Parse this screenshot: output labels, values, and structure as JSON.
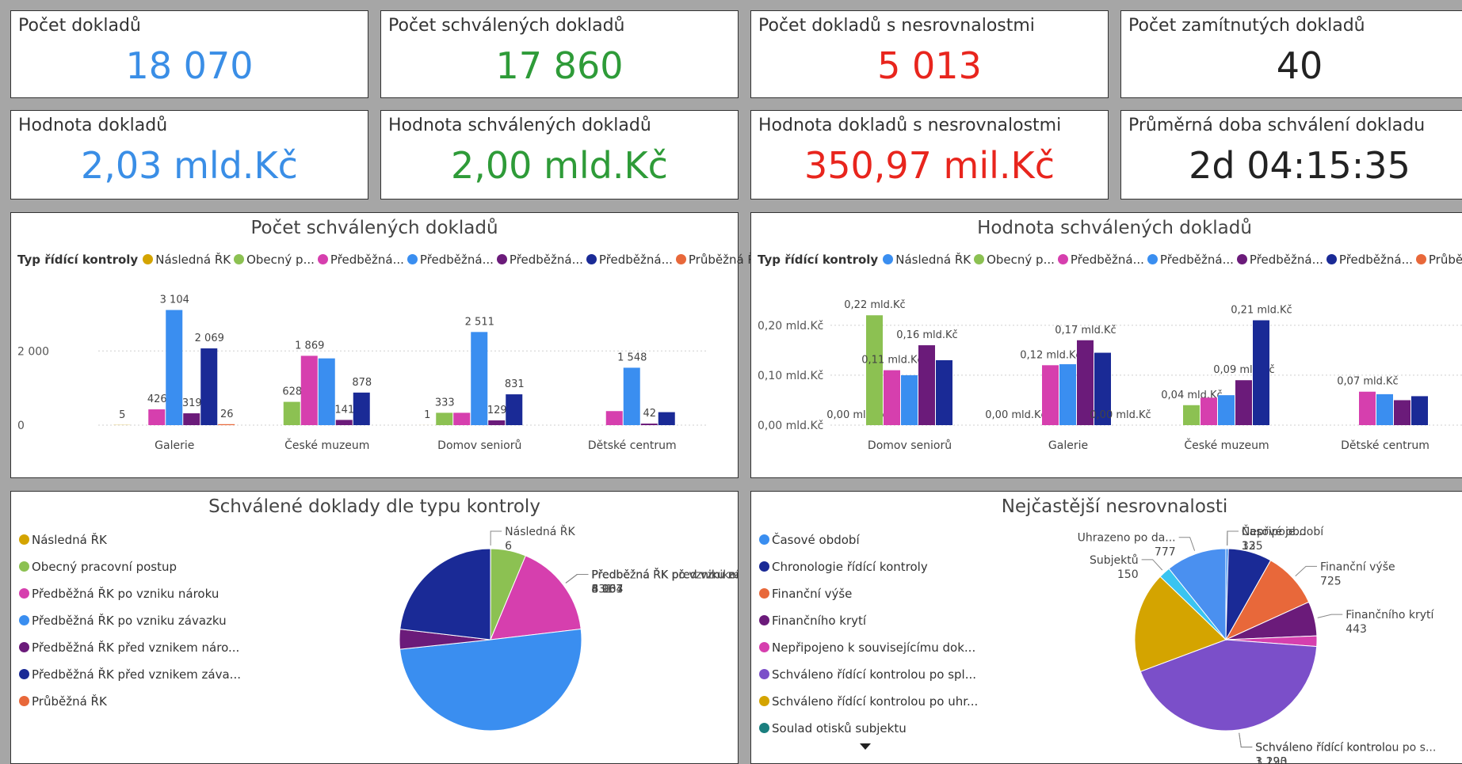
{
  "kpis": [
    {
      "label": "Počet dokladů",
      "value": "18 070",
      "color": "#3a8ee6"
    },
    {
      "label": "Počet schválených dokladů",
      "value": "17 860",
      "color": "#2e9b38"
    },
    {
      "label": "Počet dokladů s nesrovnalostmi",
      "value": "5 013",
      "color": "#e8251d"
    },
    {
      "label": "Počet zamítnutých dokladů",
      "value": "40",
      "color": "#222222"
    },
    {
      "label": "Hodnota dokladů",
      "value": "2,03 mld.Kč",
      "color": "#3a8ee6"
    },
    {
      "label": "Hodnota schválených dokladů",
      "value": "2,00 mld.Kč",
      "color": "#2e9b38"
    },
    {
      "label": "Hodnota dokladů s nesrovnalostmi",
      "value": "350,97 mil.Kč",
      "color": "#e8251d"
    },
    {
      "label": "Průměrná doba schválení dokladu",
      "value": "2d 04:15:35",
      "color": "#222222"
    }
  ],
  "legend_types": {
    "title": "Typ řídící kontroly",
    "items": [
      {
        "label": "Následná ŘK",
        "color": "#d4a400"
      },
      {
        "label": "Obecný p...",
        "color": "#8cc152"
      },
      {
        "label": "Předběžná...",
        "color": "#d63fae"
      },
      {
        "label": "Předběžná...",
        "color": "#3a8ef0"
      },
      {
        "label": "Předběžná...",
        "color": "#6b1b7a"
      },
      {
        "label": "Předběžná...",
        "color": "#1a2a96"
      },
      {
        "label": "Průběžná ŘK",
        "color": "#e8683a"
      }
    ]
  },
  "legend_types_right": {
    "title": "Typ řídící kontroly",
    "items": [
      {
        "label": "Následná ŘK",
        "color": "#3a8ef0"
      },
      {
        "label": "Obecný p...",
        "color": "#8cc152"
      },
      {
        "label": "Předběžná...",
        "color": "#d63fae"
      },
      {
        "label": "Předběžná...",
        "color": "#3a8ef0"
      },
      {
        "label": "Předběžná...",
        "color": "#6b1b7a"
      },
      {
        "label": "Předběžná...",
        "color": "#1a2a96"
      },
      {
        "label": "Průběžná Ř",
        "color": "#e8683a"
      }
    ]
  },
  "chart_data": [
    {
      "type": "bar",
      "title": "Počet schválených dokladů",
      "categories": [
        "Galerie",
        "České muzeum",
        "Domov seniorů",
        "Dětské centrum"
      ],
      "yticks": [
        {
          "v": 0,
          "label": "0"
        },
        {
          "v": 2000,
          "label": "2 000"
        }
      ],
      "ylim": [
        0,
        3500
      ],
      "series": [
        {
          "name": "Následná ŘK",
          "color": "#d4a400",
          "values": [
            5,
            0,
            1,
            0
          ],
          "labels": [
            "5",
            "",
            "1",
            ""
          ]
        },
        {
          "name": "Obecný p...",
          "color": "#8cc152",
          "values": [
            0,
            628,
            333,
            0
          ],
          "labels": [
            "",
            "628",
            "333",
            ""
          ]
        },
        {
          "name": "Předběžná...",
          "color": "#d63fae",
          "values": [
            426,
            1869,
            333,
            379
          ],
          "labels": [
            "426",
            "1 869",
            "",
            ""
          ]
        },
        {
          "name": "Předběžná...",
          "color": "#3a8ef0",
          "values": [
            3104,
            1800,
            2511,
            1548
          ],
          "labels": [
            "3 104",
            "",
            "2 511",
            "1 548"
          ]
        },
        {
          "name": "Předběžná...",
          "color": "#6b1b7a",
          "values": [
            319,
            141,
            129,
            42
          ],
          "labels": [
            "319",
            "141",
            "129",
            "42"
          ]
        },
        {
          "name": "Předběžná...",
          "color": "#1a2a96",
          "values": [
            2069,
            878,
            831,
            350
          ],
          "labels": [
            "2 069",
            "878",
            "831",
            ""
          ]
        },
        {
          "name": "Průběžná ŘK",
          "color": "#e8683a",
          "values": [
            26,
            0,
            0,
            0
          ],
          "labels": [
            "26",
            "",
            "",
            ""
          ]
        }
      ]
    },
    {
      "type": "bar",
      "title": "Hodnota schválených dokladů",
      "categories": [
        "Domov seniorů",
        "Galerie",
        "České muzeum",
        "Dětské centrum"
      ],
      "yticks": [
        {
          "v": 0,
          "label": "0,00 mld.Kč"
        },
        {
          "v": 0.1,
          "label": "0,10 mld.Kč"
        },
        {
          "v": 0.2,
          "label": "0,20 mld.Kč"
        }
      ],
      "ylim": [
        0,
        0.26
      ],
      "series": [
        {
          "name": "Následná ŘK",
          "color": "#3a8ef0",
          "values": [
            0,
            0,
            0,
            0
          ],
          "labels": [
            "0,00 mld.Kč",
            "0,00 mld.Kč",
            "",
            ""
          ]
        },
        {
          "name": "Obecný p...",
          "color": "#8cc152",
          "values": [
            0.22,
            0,
            0.04,
            0
          ],
          "labels": [
            "0,22 mld.Kč",
            "",
            "0,04 mld.Kč",
            ""
          ]
        },
        {
          "name": "Předběžná...",
          "color": "#d63fae",
          "values": [
            0.11,
            0.12,
            0.055,
            0.067
          ],
          "labels": [
            "0,11 mld.Kč",
            "0,12 mld.Kč",
            "",
            "0,07 mld.Kč"
          ]
        },
        {
          "name": "Předběžná...",
          "color": "#3a8ef0",
          "values": [
            0.1,
            0.122,
            0.06,
            0.062
          ],
          "labels": [
            "",
            "",
            "",
            ""
          ]
        },
        {
          "name": "Předběžná...",
          "color": "#6b1b7a",
          "values": [
            0.16,
            0.17,
            0.09,
            0.05
          ],
          "labels": [
            "0,16 mld.Kč",
            "0,17 mld.Kč",
            "0,09 mld.Kč",
            ""
          ]
        },
        {
          "name": "Předběžná...",
          "color": "#1a2a96",
          "values": [
            0.13,
            0.145,
            0.21,
            0.058
          ],
          "labels": [
            "",
            "",
            "0,21 mld.Kč",
            ""
          ]
        },
        {
          "name": "Průběžná Ř",
          "color": "#e8683a",
          "values": [
            0,
            0,
            0,
            0
          ],
          "labels": [
            "",
            "0,00 mld.Kč",
            "",
            ""
          ]
        }
      ]
    },
    {
      "type": "pie",
      "title": "Schválené doklady dle typu kontroly",
      "legend": [
        {
          "label": "Následná ŘK",
          "color": "#d4a400"
        },
        {
          "label": "Obecný pracovní postup",
          "color": "#8cc152"
        },
        {
          "label": "Předběžná ŘK po vzniku nároku",
          "color": "#d63fae"
        },
        {
          "label": "Předběžná ŘK po vzniku závazku",
          "color": "#3a8ef0"
        },
        {
          "label": "Předběžná ŘK před vznikem náro...",
          "color": "#6b1b7a"
        },
        {
          "label": "Předběžná ŘK před vznikem záva...",
          "color": "#1a2a96"
        },
        {
          "label": "Průběžná ŘK",
          "color": "#e8683a"
        }
      ],
      "slices": [
        {
          "label": "Následná ŘK",
          "value": 6,
          "color": "#d4a400"
        },
        {
          "label": "Obecný pracovní postup",
          "value": 1119,
          "color": "#8cc152"
        },
        {
          "label": "Předběžná ŘK po vzniku nároku",
          "value": 3007,
          "color": "#d63fae"
        },
        {
          "label": "Předběžná ŘK po vzniku závazku",
          "value": 8964,
          "color": "#3a8ef0"
        },
        {
          "label": "Předběžná ŘK před vznikem nároku",
          "value": 631,
          "color": "#6b1b7a"
        },
        {
          "label": "Předběžná ŘK před vznikem závazku",
          "value": 4133,
          "color": "#1a2a96"
        }
      ],
      "callouts": [
        {
          "name": "Následná ŘK",
          "value": "6"
        },
        {
          "name": "Předběžná ŘK po vzniku n...",
          "value": "3 007"
        },
        {
          "name": "Předběžná ŘK po vzniku záva...",
          "value": "8 964"
        },
        {
          "name": "Předběžná ŘK před vz...",
          "value": "631"
        },
        {
          "name": "Předběžná ŘK před vznikem závaz...",
          "value": "4 133"
        }
      ]
    },
    {
      "type": "pie",
      "title": "Nejčastější nesrovnalosti",
      "legend": [
        {
          "label": "Časové období",
          "color": "#3a8ef0"
        },
        {
          "label": "Chronologie řídící kontroly",
          "color": "#1a2a96"
        },
        {
          "label": "Finanční výše",
          "color": "#e8683a"
        },
        {
          "label": "Finančního krytí",
          "color": "#6b1b7a"
        },
        {
          "label": "Nepřipojeno k souvisejícímu dok...",
          "color": "#d63fae"
        },
        {
          "label": "Schváleno řídící kontrolou po spl...",
          "color": "#7b4fc9"
        },
        {
          "label": "Schváleno řídící kontrolou po uhr...",
          "color": "#d4a400"
        },
        {
          "label": "Soulad otisků subjektu",
          "color": "#1a7f7f"
        }
      ],
      "slices": [
        {
          "label": "Časové období",
          "value": 32,
          "color": "#3a8ef0"
        },
        {
          "label": "Chronologie řídící kontroly",
          "value": 560,
          "color": "#1a2a96"
        },
        {
          "label": "Finanční výše",
          "value": 725,
          "color": "#e8683a"
        },
        {
          "label": "Finančního krytí",
          "value": 443,
          "color": "#6b1b7a"
        },
        {
          "label": "Nepřipojeno k souvisejícímu dok...",
          "value": 135,
          "color": "#d63fae"
        },
        {
          "label": "Schváleno řídící kontrolou po s...",
          "value": 3120,
          "color": "#7b4fc9"
        },
        {
          "label": "Schváleno řídící kontrol...",
          "value": 1293,
          "color": "#d4a400"
        },
        {
          "label": "Subjektů",
          "value": 150,
          "color": "#3ac4f0"
        },
        {
          "label": "Uhrazeno po da...",
          "value": 777,
          "color": "#4a90f0"
        }
      ],
      "callouts": [
        {
          "name": "Časové období",
          "value": "32"
        },
        {
          "name": "Finanční výše",
          "value": "725"
        },
        {
          "name": "Finančního krytí",
          "value": "443"
        },
        {
          "name": "Nepřipoje...",
          "value": "135"
        },
        {
          "name": "Schváleno řídící kontrolou po s...",
          "value": "3 120"
        },
        {
          "name": "Schváleno řídící kontrol...",
          "value": "1 293"
        },
        {
          "name": "Subjektů",
          "value": "150"
        },
        {
          "name": "Uhrazeno po da...",
          "value": "777"
        }
      ]
    }
  ]
}
